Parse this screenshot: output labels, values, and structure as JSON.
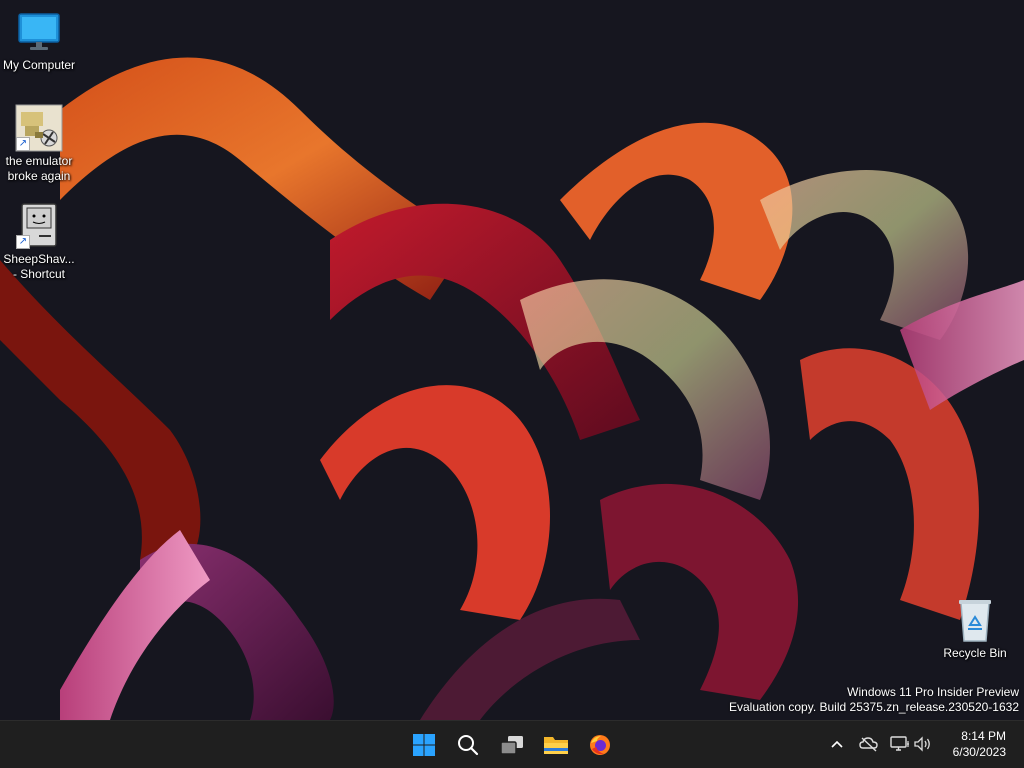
{
  "desktop": {
    "icons": [
      {
        "label": "My Computer",
        "icon": "monitor-icon"
      },
      {
        "label": "the emulator\nbroke again",
        "icon": "emulator-shortcut-icon"
      },
      {
        "label": "SheepShav...\n- Shortcut",
        "icon": "classic-mac-icon"
      },
      {
        "label": "Recycle Bin",
        "icon": "recycle-bin-icon"
      }
    ],
    "watermark": {
      "line1": "Windows 11 Pro Insider Preview",
      "line2": "Evaluation copy. Build 25375.zn_release.230520-1632"
    }
  },
  "taskbar": {
    "apps": [
      {
        "name": "Start",
        "icon": "windows-start-icon"
      },
      {
        "name": "Search",
        "icon": "search-icon"
      },
      {
        "name": "Task View",
        "icon": "task-view-icon"
      },
      {
        "name": "File Explorer",
        "icon": "folder-icon"
      },
      {
        "name": "Firefox",
        "icon": "firefox-icon"
      }
    ],
    "tray": {
      "icons": [
        "chevron-up-icon",
        "onedrive-offline-icon",
        "network-icon",
        "volume-icon"
      ],
      "time": "8:14 PM",
      "date": "6/30/2023"
    }
  },
  "colors": {
    "taskbar_bg": "#1f1f1f",
    "accent": "#2aa3ff",
    "desktop_bg": "#15151f"
  }
}
